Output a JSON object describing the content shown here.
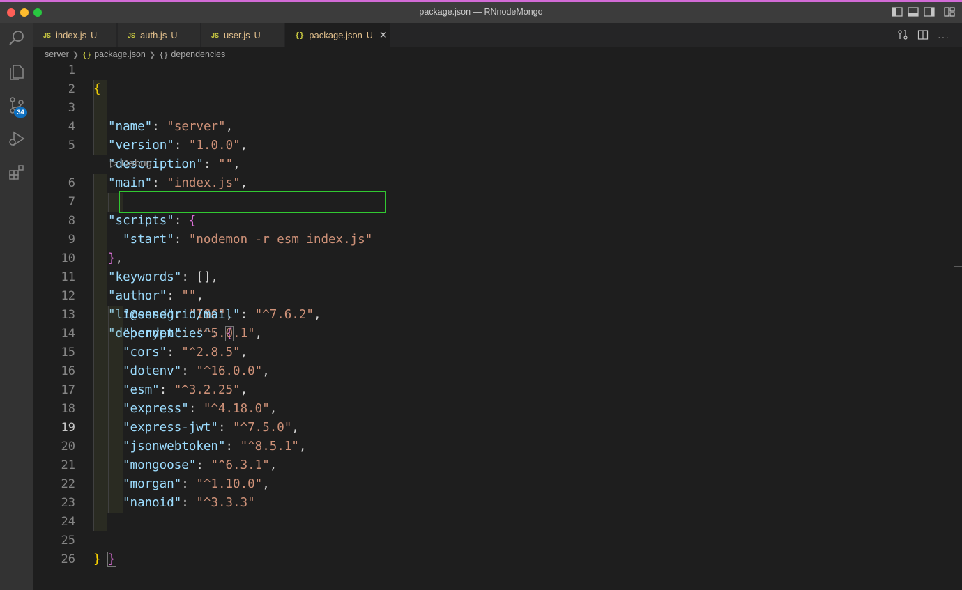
{
  "window": {
    "title": "package.json — RNnodeMongo"
  },
  "activity_bar": {
    "items": [
      "explorer-icon",
      "search-icon",
      "source-control-icon",
      "run-debug-icon",
      "extensions-icon"
    ],
    "source_control_badge": "34"
  },
  "tabs": [
    {
      "icon": "JS",
      "label": "index.js",
      "status": "U",
      "active": false
    },
    {
      "icon": "JS",
      "label": "auth.js",
      "status": "U",
      "active": false
    },
    {
      "icon": "JS",
      "label": "user.js",
      "status": "U",
      "active": false
    },
    {
      "icon": "{}",
      "label": "package.json",
      "status": "U",
      "active": true
    }
  ],
  "breadcrumb": {
    "folder": "server",
    "file": "package.json",
    "symbol": "dependencies",
    "braces": "{}"
  },
  "editor": {
    "codelens": "Debug",
    "current_line": 19,
    "lines": [
      {
        "n": "1"
      },
      {
        "n": "2"
      },
      {
        "n": "3"
      },
      {
        "n": "4"
      },
      {
        "n": "5"
      },
      {
        "n": "6"
      },
      {
        "n": "7"
      },
      {
        "n": "8"
      },
      {
        "n": "9"
      },
      {
        "n": "10"
      },
      {
        "n": "11"
      },
      {
        "n": "12"
      },
      {
        "n": "13"
      },
      {
        "n": "14"
      },
      {
        "n": "15"
      },
      {
        "n": "16"
      },
      {
        "n": "17"
      },
      {
        "n": "18"
      },
      {
        "n": "19"
      },
      {
        "n": "20"
      },
      {
        "n": "21"
      },
      {
        "n": "22"
      },
      {
        "n": "23"
      },
      {
        "n": "24"
      },
      {
        "n": "25"
      },
      {
        "n": "26"
      }
    ],
    "fields": {
      "name": {
        "key": "\"name\"",
        "value": "\"server\""
      },
      "version": {
        "key": "\"version\"",
        "value": "\"1.0.0\""
      },
      "description": {
        "key": "\"description\"",
        "value": "\"\""
      },
      "main": {
        "key": "\"main\"",
        "value": "\"index.js\""
      },
      "scripts": {
        "key": "\"scripts\""
      },
      "start": {
        "key": "\"start\"",
        "value": "\"nodemon -r esm index.js\""
      },
      "keywords": {
        "key": "\"keywords\"",
        "value": "[]"
      },
      "author": {
        "key": "\"author\"",
        "value": "\"\""
      },
      "license": {
        "key": "\"license\"",
        "value": "\"ISC\""
      },
      "dependencies": {
        "key": "\"dependencies\""
      }
    },
    "dependencies": [
      {
        "key": "\"@sendgrid/mail\"",
        "value": "\"^7.6.2\""
      },
      {
        "key": "\"bcrypt\"",
        "value": "\"^5.0.1\""
      },
      {
        "key": "\"cors\"",
        "value": "\"^2.8.5\""
      },
      {
        "key": "\"dotenv\"",
        "value": "\"^16.0.0\""
      },
      {
        "key": "\"esm\"",
        "value": "\"^3.2.25\""
      },
      {
        "key": "\"express\"",
        "value": "\"^4.18.0\""
      },
      {
        "key": "\"express-jwt\"",
        "value": "\"^7.5.0\""
      },
      {
        "key": "\"jsonwebtoken\"",
        "value": "\"^8.5.1\""
      },
      {
        "key": "\"mongoose\"",
        "value": "\"^6.3.1\""
      },
      {
        "key": "\"morgan\"",
        "value": "\"^1.10.0\""
      },
      {
        "key": "\"nanoid\"",
        "value": "\"^3.3.3\""
      }
    ]
  },
  "colors": {
    "key": "#9cdcfe",
    "string": "#ce9178",
    "highlight_box": "#31c831",
    "untracked": "#e2c08d",
    "badge": "#0e70c0"
  }
}
